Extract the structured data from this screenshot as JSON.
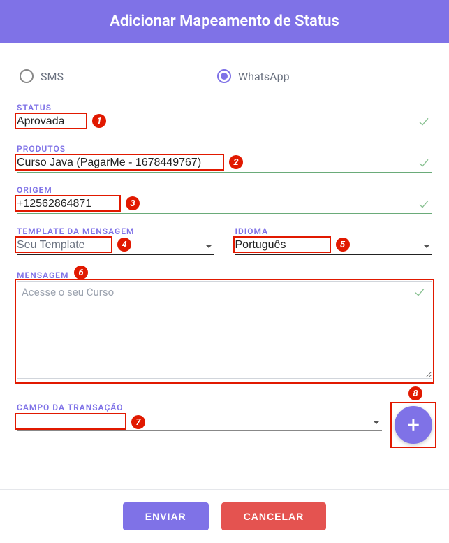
{
  "header": {
    "title": "Adicionar Mapeamento de Status"
  },
  "radios": {
    "sms": "SMS",
    "whatsapp": "WhatsApp"
  },
  "labels": {
    "status": "STATUS",
    "produtos": "PRODUTOS",
    "origem": "ORIGEM",
    "template": "TEMPLATE DA MENSAGEM",
    "idioma": "IDIOMA",
    "mensagem": "MENSAGEM",
    "campo": "CAMPO DA TRANSAÇÃO"
  },
  "values": {
    "status": "Aprovada",
    "produtos": "Curso Java (PagarMe - 1678449767)",
    "origem": "+12562864871",
    "template": "Seu Template",
    "idioma": "Português",
    "mensagem": "Acesse o seu Curso",
    "campo": ""
  },
  "buttons": {
    "send": "ENVIAR",
    "cancel": "CANCELAR",
    "add": "+"
  },
  "annotations": [
    "1",
    "2",
    "3",
    "4",
    "5",
    "6",
    "7",
    "8"
  ]
}
